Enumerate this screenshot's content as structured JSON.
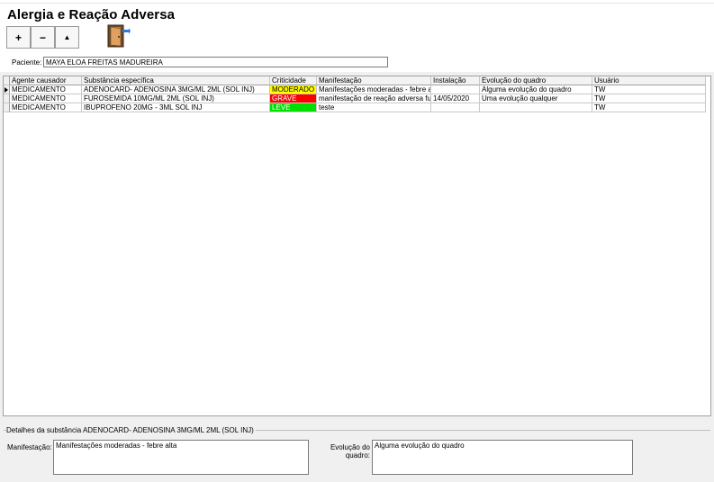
{
  "window": {
    "title": "Alergia e Reação Adversa"
  },
  "toolbar": {
    "add_label": "+",
    "remove_label": "−",
    "up_label": "▲",
    "exit_icon": "door-exit-icon"
  },
  "patient": {
    "label": "Paciente:",
    "value": "MAYA ELOA FREITAS MADUREIRA"
  },
  "grid": {
    "columns": [
      "Agente causador",
      "Substância específica",
      "Criticidade",
      "Manifestação",
      "Instalação",
      "Evolução do quadro",
      "Usuário"
    ],
    "rows": [
      [
        "MEDICAMENTO",
        "ADENOCARD- ADENOSINA 3MG/ML 2ML (SOL INJ)",
        "MODERADO",
        "Manifestações moderadas - febre alta",
        "",
        "Alguma evolução do quadro",
        "TW"
      ],
      [
        "MEDICAMENTO",
        "FUROSEMIDA 10MG/ML 2ML (SOL INJ)",
        "GRAVE",
        "manifestação de reação adversa furos",
        "14/05/2020",
        "Uma evolução qualquer",
        "TW"
      ],
      [
        "MEDICAMENTO",
        "IBUPROFENO 20MG - 3ML SOL INJ",
        "LEVE",
        "teste",
        "",
        "",
        "TW"
      ]
    ],
    "criticity_colors": {
      "MODERADO": "#ffff00",
      "GRAVE": "#ff0000",
      "LEVE": "#00e000"
    },
    "selected_row": 0
  },
  "details": {
    "title": "Detalhes da substância ADENOCARD- ADENOSINA 3MG/ML 2ML (SOL INJ)",
    "manifestacao_label": "Manifestação:",
    "manifestacao_value": "Manifestações moderadas - febre alta",
    "evolucao_label": "Evolução do quadro:",
    "evolucao_value": "Alguma evolução do quadro"
  }
}
